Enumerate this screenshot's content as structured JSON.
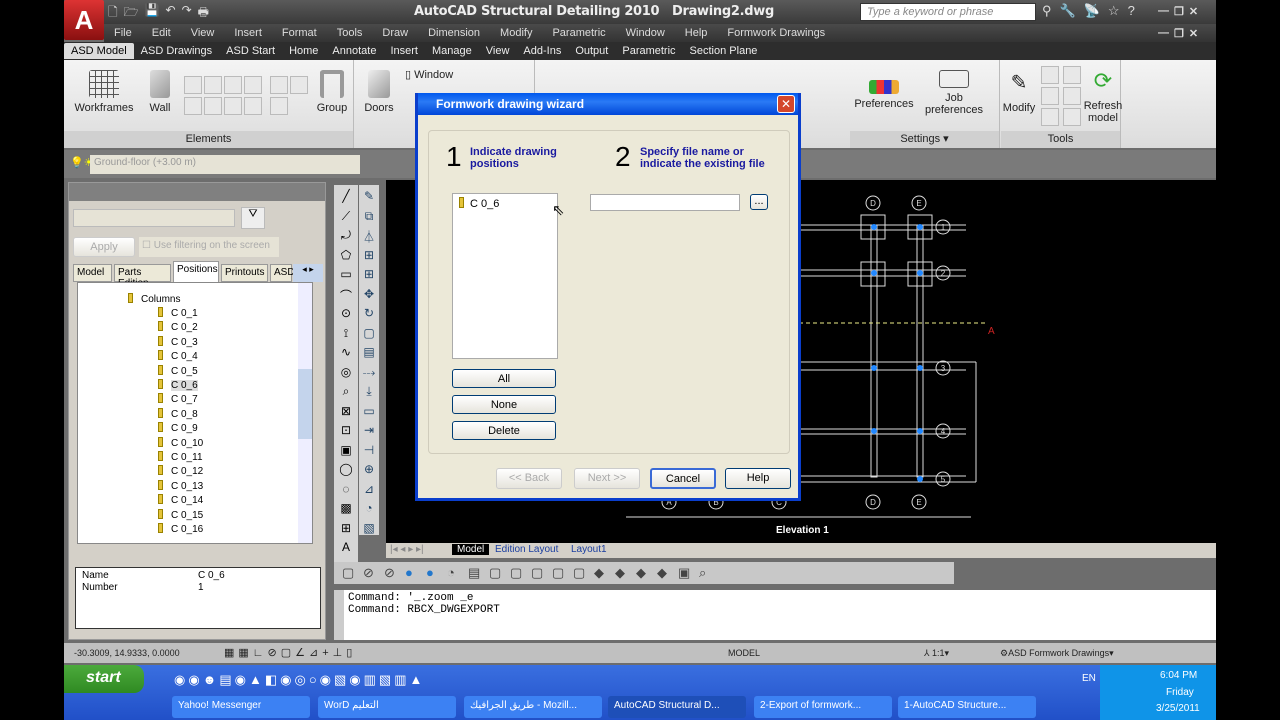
{
  "title": {
    "app": "AutoCAD Structural Detailing 2010",
    "file": "Drawing2.dwg",
    "search_placeholder": "Type a keyword or phrase"
  },
  "menu": [
    "File",
    "Edit",
    "View",
    "Insert",
    "Format",
    "Tools",
    "Draw",
    "Dimension",
    "Modify",
    "Parametric",
    "Window",
    "Help",
    "Formwork Drawings"
  ],
  "ribbon_tabs": [
    "ASD Model",
    "ASD Drawings",
    "ASD Start",
    "Home",
    "Annotate",
    "Insert",
    "Manage",
    "View",
    "Add-Ins",
    "Output",
    "Parametric",
    "Section Plane"
  ],
  "ribbon": {
    "workframes": "Workframes",
    "wall": "Wall",
    "group": "Group",
    "elements": "Elements",
    "doors": "Doors",
    "window": "Window",
    "preferences": "Preferences",
    "job_preferences": "Job preferences",
    "settings": "Settings",
    "modify": "Modify",
    "refresh_model": "Refresh model",
    "tools": "Tools"
  },
  "layer": "Ground-floor  (+3.00 m)",
  "left_panel": {
    "apply": "Apply",
    "filter_label": "Use filtering on the screen",
    "tabs": [
      "Model",
      "Parts Edition",
      "Positions",
      "Printouts",
      "ASD"
    ],
    "tree_root": "Columns",
    "tree_items": [
      "C 0_1",
      "C 0_2",
      "C 0_3",
      "C 0_4",
      "C 0_5",
      "C 0_6",
      "C 0_7",
      "C 0_8",
      "C 0_9",
      "C 0_10",
      "C 0_11",
      "C 0_12",
      "C 0_13",
      "C 0_14",
      "C 0_15",
      "C 0_16"
    ],
    "props": [
      {
        "k": "Name",
        "v": "C 0_6"
      },
      {
        "k": "Number",
        "v": "1"
      }
    ]
  },
  "dialog": {
    "title": "Formwork drawing wizard",
    "step1_num": "1",
    "step1": "Indicate drawing positions",
    "step2_num": "2",
    "step2": "Specify file name or indicate the existing file",
    "list_items": [
      "C 0_6"
    ],
    "file_value": "",
    "browse": "...",
    "all": "All",
    "none": "None",
    "delete": "Delete",
    "back": "<< Back",
    "next": "Next >>",
    "cancel": "Cancel",
    "help": "Help"
  },
  "drawing": {
    "cols": [
      "D",
      "E"
    ],
    "rows": [
      "1",
      "2",
      "3",
      "4",
      "5"
    ],
    "bottom_cols": [
      "A",
      "B",
      "C",
      "D",
      "E"
    ],
    "section_mark": "A",
    "elevation": "Elevation 1"
  },
  "layout_tabs": [
    "Model",
    "Edition Layout",
    "Layout1"
  ],
  "command_lines": [
    "Command: '_.zoom _e",
    "Command: RBCX_DWGEXPORT"
  ],
  "status": {
    "coords": "-30.3009, 14.9333, 0.0000",
    "model": "MODEL",
    "scale": "1:1",
    "workspace": "ASD Formwork Drawings"
  },
  "taskbar": {
    "start": "start",
    "tasks": [
      "Yahoo! Messenger",
      "WorD التعليم",
      "طريق الجرافيك - Mozill...",
      "AutoCAD Structural D...",
      "2-Export of formwork...",
      "1-AutoCAD Structure..."
    ],
    "lang": "EN",
    "time": "6:04 PM",
    "day": "Friday",
    "date": "3/25/2011"
  }
}
